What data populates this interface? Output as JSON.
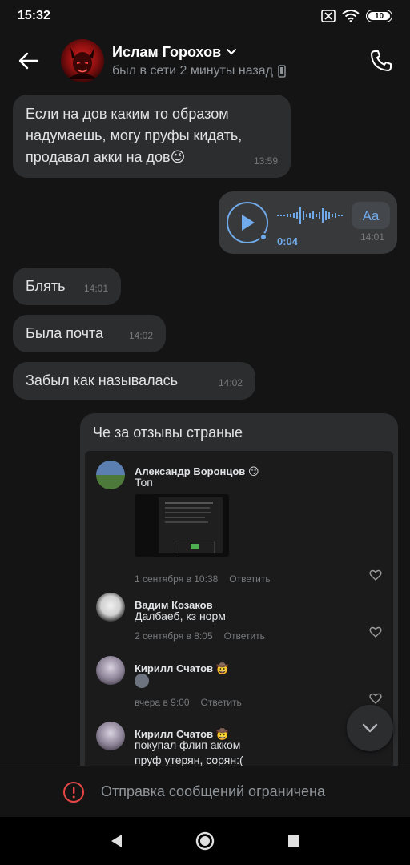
{
  "status_bar": {
    "time": "15:32",
    "battery": "10"
  },
  "header": {
    "contact_name": "Ислам Горохов",
    "contact_status": "был в сети 2 минуты назад"
  },
  "messages": [
    {
      "text": "Если на дов каким то образом надумаешь, могу пруфы кидать, продавал акки на дов😉",
      "time": "13:59",
      "direction": "in"
    },
    {
      "type": "voice",
      "duration": "0:04",
      "transcribe_label": "Aa",
      "time": "14:01",
      "direction": "out"
    },
    {
      "text": "Блять",
      "time": "14:01",
      "direction": "in"
    },
    {
      "text": "Была почта",
      "time": "14:02",
      "direction": "in"
    },
    {
      "text": "Забыл как называлась",
      "time": "14:02",
      "direction": "in"
    },
    {
      "text": "Че за отзывы страные",
      "direction": "in"
    }
  ],
  "screenshot_comments": [
    {
      "name": "Александр Воронцов",
      "badge": "😏",
      "text": "Топ",
      "date": "1 сентября в 10:38",
      "reply": "Ответить"
    },
    {
      "name": "Вадим Козаков",
      "badge": "",
      "text": "Далбаеб, кз норм",
      "date": "2 сентября в 8:05",
      "reply": "Ответить"
    },
    {
      "name": "Кирилл Счатов",
      "badge": "🤠",
      "text": "",
      "date": "вчера в 9:00",
      "reply": "Ответить"
    },
    {
      "name": "Кирилл Счатов",
      "badge": "🤠",
      "text": "покупал флип акком",
      "text2": "пруф утерян, сорян:(",
      "date": "",
      "reply": ""
    }
  ],
  "restricted_notice": "Отправка сообщений ограничена",
  "colors": {
    "background": "#141414",
    "bubble": "#2c2d2f",
    "accent": "#71aaeb",
    "danger": "#e64646"
  },
  "icons": [
    "back-arrow-icon",
    "chevron-down-icon",
    "phone-icon",
    "mobile-icon",
    "play-icon",
    "heart-icon",
    "chevron-down-icon",
    "alert-circle-icon",
    "nav-back-icon",
    "nav-home-icon",
    "nav-recents-icon"
  ]
}
